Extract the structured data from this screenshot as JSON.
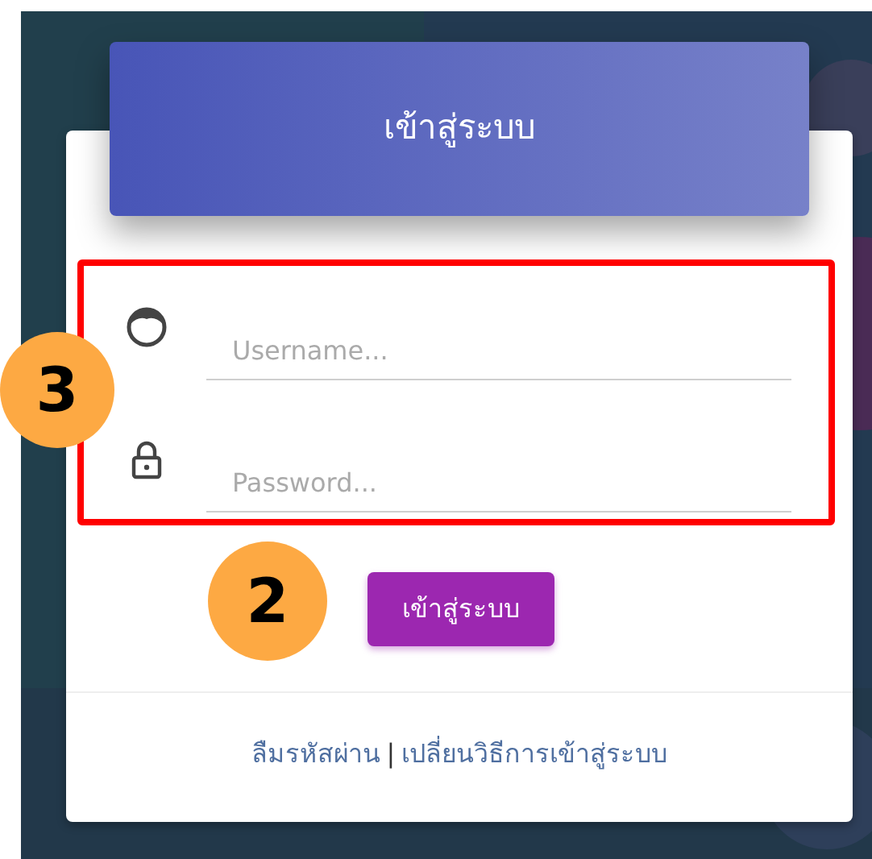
{
  "header": {
    "title": "เข้าสู่ระบบ"
  },
  "fields": [
    {
      "kind": "user",
      "placeholder": "Username..."
    },
    {
      "kind": "lock",
      "placeholder": "Password..."
    }
  ],
  "submit_button": {
    "label": "เข้าสู่ระบบ"
  },
  "footer_links": [
    {
      "kind": "link",
      "text": "ลืมรหัสผ่าน"
    },
    {
      "kind": "separator",
      "text": "|"
    },
    {
      "kind": "link",
      "text": "เปลี่ยนวิธีการเข้าสู่ระบบ"
    }
  ],
  "annotations": [
    {
      "kind": "frame"
    },
    {
      "kind": "badge",
      "number": "3"
    },
    {
      "kind": "badge",
      "number": "2"
    }
  ]
}
